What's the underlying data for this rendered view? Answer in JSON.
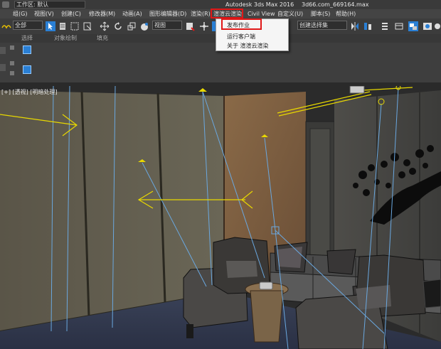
{
  "title_bar": {
    "workspace_label": "工作区: 默认",
    "app_title": "Autodesk 3ds Max 2016",
    "file_name": "3d66.com_669164.max"
  },
  "menu": {
    "items": [
      "组(G)",
      "视图(V)",
      "创建(C)",
      "修改器(M)",
      "动画(A)",
      "图形编辑器(D)",
      "渲染(R)",
      "渲渲云渲染",
      "Civil View",
      "自定义(U)",
      "脚本(S)",
      "帮助(H)"
    ]
  },
  "toolbar": {
    "selection_filter": "全部",
    "reference_coord": "视图",
    "named_selection": "创建选择集"
  },
  "ribbon": {
    "labels": [
      "选择",
      "对象绘制",
      "填充"
    ]
  },
  "dropdown": {
    "items": [
      "发布作业",
      "运行客户端",
      "关于 渲渲云渲染"
    ]
  },
  "viewport": {
    "label": "[+] [透视] [明暗处理]"
  },
  "colors": {
    "highlight_red": "#e01818",
    "toolbar_blue": "#2a7fd4",
    "light_yellow": "#e8d800"
  }
}
